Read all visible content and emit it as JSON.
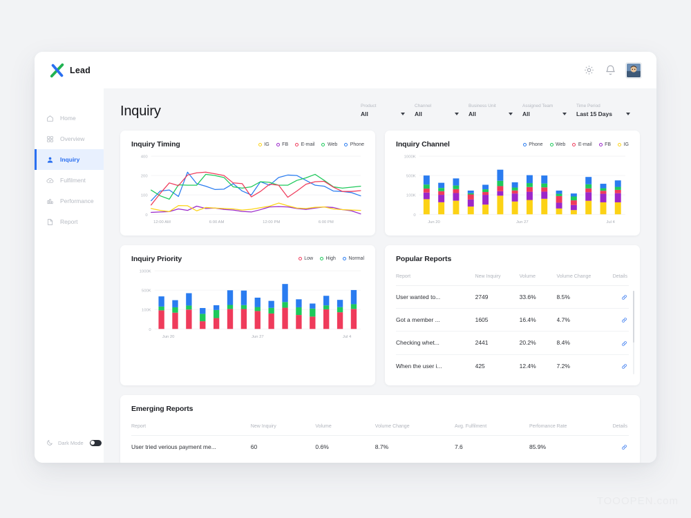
{
  "brand": {
    "name": "Lead",
    "logo_icon": "x-logo-icon",
    "green": "#21b352",
    "blue": "#2a6ff0"
  },
  "topbar": {
    "settings_icon": "gear-icon",
    "notifications_icon": "bell-icon",
    "avatar_label": "user-avatar"
  },
  "sidebar": {
    "items": [
      {
        "label": "Home",
        "icon": "home-icon",
        "active": false
      },
      {
        "label": "Overview",
        "icon": "grid-icon",
        "active": false
      },
      {
        "label": "Inquiry",
        "icon": "person-icon",
        "active": true
      },
      {
        "label": "Fulfilment",
        "icon": "cloud-check-icon",
        "active": false
      },
      {
        "label": "Performance",
        "icon": "bar-chart-icon",
        "active": false
      },
      {
        "label": "Report",
        "icon": "document-icon",
        "active": false
      }
    ],
    "dark_mode": {
      "label": "Dark Mode",
      "icon": "moon-icon",
      "enabled": false
    }
  },
  "header": {
    "title": "Inquiry"
  },
  "filters": [
    {
      "label": "Product",
      "value": "All"
    },
    {
      "label": "Channel",
      "value": "All"
    },
    {
      "label": "Business Unit",
      "value": "All"
    },
    {
      "label": "Assigned Team",
      "value": "All"
    },
    {
      "label": "Time Period",
      "value": "Last 15 Days"
    }
  ],
  "cards": {
    "inquiry_timing": {
      "title": "Inquiry Timing"
    },
    "inquiry_channel": {
      "title": "Inquiry Channel"
    },
    "inquiry_priority": {
      "title": "Inquiry Priority"
    },
    "popular_reports": {
      "title": "Popular Reports"
    },
    "emerging_reports": {
      "title": "Emerging Reports"
    }
  },
  "chart_data": [
    {
      "id": "inquiry-timing",
      "type": "line",
      "title": "Inquiry Timing",
      "xlabel": "",
      "ylabel": "",
      "grid": true,
      "legend_position": "top-right",
      "ytick_labels": [
        "400",
        "200",
        "100",
        "0"
      ],
      "ytick_values": [
        400,
        200,
        100,
        0
      ],
      "ylim": [
        0,
        400
      ],
      "xtick_labels": [
        "12:00 AM",
        "6:00 AM",
        "12:00 PM",
        "6:00 PM"
      ],
      "x": [
        0,
        1,
        2,
        3,
        4,
        5,
        6,
        7,
        8,
        9,
        10,
        11,
        12,
        13,
        14,
        15,
        16,
        17,
        18,
        19,
        20,
        21,
        22,
        23
      ],
      "series": [
        {
          "name": "Phone",
          "color": "#2a7cf0",
          "values": [
            70,
            120,
            125,
            92,
            235,
            158,
            145,
            128,
            130,
            158,
            120,
            100,
            168,
            150,
            190,
            205,
            200,
            175,
            150,
            145,
            120,
            118,
            112,
            95
          ]
        },
        {
          "name": "Web",
          "color": "#1ec95b",
          "values": [
            125,
            95,
            78,
            152,
            150,
            150,
            212,
            200,
            190,
            142,
            135,
            142,
            168,
            165,
            150,
            150,
            175,
            188,
            212,
            175,
            142,
            135,
            140,
            145
          ]
        },
        {
          "name": "E-mail",
          "color": "#ef3b5b",
          "values": [
            48,
            108,
            162,
            148,
            205,
            228,
            235,
            218,
            200,
            162,
            158,
            90,
            118,
            155,
            150,
            88,
            120,
            155,
            168,
            170,
            140,
            118,
            118,
            122
          ]
        },
        {
          "name": "FB",
          "color": "#9b27c9",
          "values": [
            10,
            12,
            14,
            28,
            20,
            42,
            30,
            32,
            25,
            22,
            15,
            12,
            24,
            38,
            40,
            38,
            30,
            25,
            32,
            38,
            35,
            24,
            18,
            2
          ]
        },
        {
          "name": "IG",
          "color": "#fcd215",
          "values": [
            30,
            20,
            14,
            45,
            44,
            18,
            35,
            32,
            30,
            28,
            22,
            26,
            34,
            42,
            58,
            44,
            32,
            30,
            36,
            38,
            28,
            24,
            22,
            20
          ]
        }
      ]
    },
    {
      "id": "inquiry-channel",
      "type": "bar",
      "stacked": true,
      "title": "Inquiry Channel",
      "grid": true,
      "legend_position": "top-right",
      "ytick_labels": [
        "1000K",
        "500K",
        "100K",
        "0"
      ],
      "ytick_values": [
        1000,
        500,
        100,
        0
      ],
      "ylim": [
        0,
        1000
      ],
      "xtick_labels": [
        "Jun 20",
        "Jun 27",
        "Jul 4"
      ],
      "categories": [
        "Jun 20",
        "Jun 21",
        "Jun 22",
        "Jun 23",
        "Jun 24",
        "Jun 25",
        "Jun 26",
        "Jun 27",
        "Jun 28",
        "Jun 29",
        "Jun 30",
        "Jul 1",
        "Jul 2",
        "Jul 3",
        "Jul 4"
      ],
      "series": [
        {
          "name": "IG",
          "color": "#fcd215",
          "values": [
            78,
            62,
            70,
            40,
            50,
            96,
            66,
            74,
            80,
            30,
            22,
            70,
            62,
            62,
            0
          ]
        },
        {
          "name": "FB",
          "color": "#9b27c9",
          "values": [
            70,
            40,
            70,
            36,
            52,
            82,
            64,
            92,
            88,
            30,
            26,
            86,
            62,
            74,
            0
          ]
        },
        {
          "name": "E-mail",
          "color": "#ef3b5b",
          "values": [
            82,
            76,
            80,
            34,
            58,
            104,
            62,
            96,
            88,
            34,
            24,
            78,
            62,
            68,
            0
          ]
        },
        {
          "name": "Web",
          "color": "#1ec95b",
          "values": [
            84,
            66,
            74,
            26,
            56,
            110,
            60,
            82,
            80,
            30,
            20,
            86,
            52,
            62,
            0
          ]
        },
        {
          "name": "Phone",
          "color": "#2a7cf0",
          "values": [
            186,
            106,
            146,
            54,
            94,
            258,
            108,
            166,
            164,
            66,
            38,
            150,
            92,
            134,
            0
          ]
        }
      ]
    },
    {
      "id": "inquiry-priority",
      "type": "bar",
      "stacked": true,
      "title": "Inquiry Priority",
      "grid": true,
      "legend_position": "top-right",
      "ytick_labels": [
        "1000K",
        "500K",
        "100K",
        "0"
      ],
      "ytick_values": [
        1000,
        500,
        100,
        0
      ],
      "ylim": [
        0,
        1000
      ],
      "xtick_labels": [
        "Jun 20",
        "Jun 27",
        "Jul 4"
      ],
      "categories": [
        "Jun 20",
        "Jun 21",
        "Jun 22",
        "Jun 23",
        "Jun 24",
        "Jun 25",
        "Jun 26",
        "Jun 27",
        "Jun 28",
        "Jun 29",
        "Jun 30",
        "Jul 1",
        "Jul 2",
        "Jul 3",
        "Jul 4"
      ],
      "series": [
        {
          "name": "Low",
          "color": "#ef3b5b",
          "values": [
            96,
            84,
            100,
            40,
            56,
            112,
            110,
            92,
            80,
            138,
            72,
            64,
            104,
            86,
            112
          ]
        },
        {
          "name": "High",
          "color": "#1ec95b",
          "values": [
            66,
            62,
            82,
            38,
            42,
            84,
            82,
            60,
            56,
            118,
            74,
            56,
            82,
            64,
            100
          ]
        },
        {
          "name": "Normal",
          "color": "#2a7cf0",
          "values": [
            210,
            148,
            256,
            54,
            92,
            302,
            300,
            194,
            144,
            404,
            166,
            104,
            198,
            150,
            292
          ]
        }
      ]
    }
  ],
  "popular_reports": {
    "columns": [
      "Report",
      "New Inquiry",
      "Volume",
      "Volume Change",
      "Details"
    ],
    "rows": [
      {
        "report": "User wanted to...",
        "new_inquiry": "2749",
        "volume": "33.6%",
        "volume_change": "8.5%",
        "details_icon": "link-icon"
      },
      {
        "report": "Got a member ...",
        "new_inquiry": "1605",
        "volume": "16.4%",
        "volume_change": "4.7%",
        "details_icon": "link-icon"
      },
      {
        "report": "Checking whet...",
        "new_inquiry": "2441",
        "volume": "20.2%",
        "volume_change": "8.4%",
        "details_icon": "link-icon"
      },
      {
        "report": "When the user i...",
        "new_inquiry": "425",
        "volume": "12.4%",
        "volume_change": "7.2%",
        "details_icon": "link-icon"
      }
    ]
  },
  "emerging_reports": {
    "columns": [
      "Report",
      "New Inquiry",
      "Volume",
      "Volume Change",
      "Avg. Fulfilment",
      "Perfomance Rate",
      "Details"
    ],
    "rows": [
      {
        "report": "User tried verious payment me...",
        "new_inquiry": "60",
        "volume": "0.6%",
        "volume_change": "8.7%",
        "avg_fulfilment": "7.6",
        "performance_rate": "85.9%",
        "details_icon": "link-icon"
      }
    ]
  },
  "watermark": {
    "text": "TOOOPEN.com"
  }
}
